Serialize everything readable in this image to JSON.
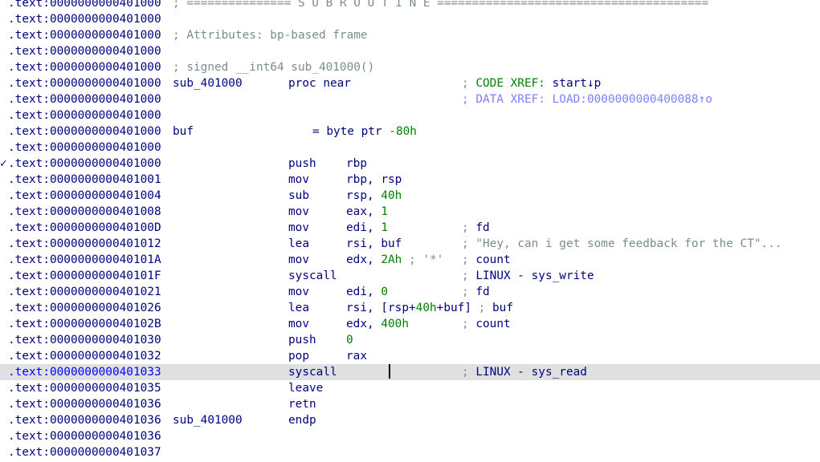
{
  "lines": [
    {
      "addr": ".text:0000000000401000",
      "separator": "; =============== S U B R O U T I N E ======================================="
    },
    {
      "addr": ".text:0000000000401000"
    },
    {
      "addr": ".text:0000000000401000",
      "attr": "; Attributes: bp-based frame"
    },
    {
      "addr": ".text:0000000000401000"
    },
    {
      "addr": ".text:0000000000401000",
      "attr": "; signed __int64 sub_401000()"
    },
    {
      "addr": ".text:0000000000401000",
      "label": "sub_401000",
      "op": "proc near",
      "comment_prefix": "; ",
      "comment_green": "CODE XREF: ",
      "comment_blue": "start↓p"
    },
    {
      "addr": ".text:0000000000401000",
      "comment_ref": "; DATA XREF: LOAD:0000000000400088↑o"
    },
    {
      "addr": ".text:0000000000401000"
    },
    {
      "addr": ".text:0000000000401000",
      "label": "buf",
      "eq_lhs": "= byte ptr ",
      "eq_num": "-80h"
    },
    {
      "addr": ".text:0000000000401000"
    },
    {
      "mark": "✓",
      "addr": ".text:0000000000401000",
      "op": "push",
      "reg1": "rbp"
    },
    {
      "addr": ".text:0000000000401001",
      "op": "mov",
      "reg1": "rbp",
      "sep": ", ",
      "reg2": "rsp"
    },
    {
      "addr": ".text:0000000000401004",
      "op": "sub",
      "reg1": "rsp",
      "sep": ", ",
      "num": "40h"
    },
    {
      "addr": ".text:0000000000401008",
      "op": "mov",
      "reg1": "eax",
      "sep": ", ",
      "num": "1"
    },
    {
      "addr": ".text:000000000040100D",
      "op": "mov",
      "reg1": "edi",
      "sep": ", ",
      "num": "1",
      "comment_prefix": "; ",
      "comment_blue": "fd"
    },
    {
      "addr": ".text:0000000000401012",
      "op": "lea",
      "reg1": "rsi",
      "sep": ", ",
      "reg2": "buf",
      "comment_str": "; \"Hey, can i get some feedback for the CT\"..."
    },
    {
      "addr": ".text:000000000040101A",
      "op": "mov",
      "reg1": "edx",
      "sep": ", ",
      "num": "2Ah",
      "inline_cmt": " ; '*'",
      "comment_prefix": "; ",
      "comment_blue": "count"
    },
    {
      "addr": ".text:000000000040101F",
      "op": "syscall",
      "comment_prefix": "; ",
      "comment_blue": "LINUX - sys_write"
    },
    {
      "addr": ".text:0000000000401021",
      "op": "mov",
      "reg1": "edi",
      "sep": ", ",
      "num": "0",
      "comment_prefix": "; ",
      "comment_blue": "fd"
    },
    {
      "addr": ".text:0000000000401026",
      "op": "lea",
      "reg1": "rsi",
      "sep": ", [",
      "reg2": "rsp",
      "sep2": "+",
      "num2": "40h",
      "sep3": "+",
      "reg3": "buf",
      "sep4": "]",
      "tail_prefix": " ; ",
      "tail_blue": "buf"
    },
    {
      "addr": ".text:000000000040102B",
      "op": "mov",
      "reg1": "edx",
      "sep": ", ",
      "num": "400h",
      "comment_prefix": "; ",
      "comment_blue": "count"
    },
    {
      "addr": ".text:0000000000401030",
      "op": "push",
      "num": "0"
    },
    {
      "addr": ".text:0000000000401032",
      "op": "pop",
      "reg1": "rax"
    },
    {
      "addr": ".text:0000000000401033",
      "op": "syscall",
      "comment_prefix": "; ",
      "comment_blue": "LINUX - sys_read",
      "highlight": true
    },
    {
      "addr": ".text:0000000000401035",
      "op": "leave"
    },
    {
      "addr": ".text:0000000000401036",
      "op": "retn"
    },
    {
      "addr": ".text:0000000000401036",
      "label": "sub_401000",
      "op": "endp"
    },
    {
      "addr": ".text:0000000000401036"
    },
    {
      "addr": ".text:0000000000401037"
    }
  ]
}
